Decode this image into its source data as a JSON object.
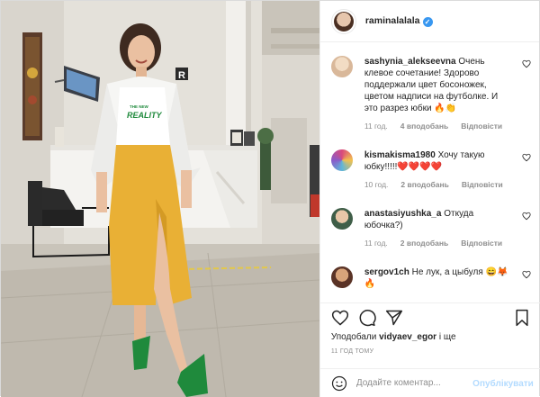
{
  "post": {
    "author": "raminalalala",
    "verified": true
  },
  "photo": {
    "tshirt_text_top": "THE NEW",
    "tshirt_text_main": "REALITY",
    "sign_letter": "R"
  },
  "comments": [
    {
      "username": "sashynia_alekseevna",
      "text": "Очень клевое сочетание! Здорово поддержали цвет босоножек, цветом надписи на футболке. И это разрез юбки 🔥👏",
      "age": "11 год.",
      "likes": "4 вподобань",
      "reply": "Відповісти",
      "avatar_color": "#e9d2b6"
    },
    {
      "username": "kismakisma1980",
      "text": "Хочу такую юбку!!!!!❤️❤️❤️❤️",
      "age": "10 год.",
      "likes": "2 вподобань",
      "reply": "Відповісти",
      "avatar_color": "#c94b8a"
    },
    {
      "username": "anastasiyushka_a",
      "text": "Откуда юбочка?)",
      "age": "11 год.",
      "likes": "2 вподобань",
      "reply": "Відповісти",
      "avatar_color": "#5b8a6b"
    },
    {
      "username": "sergov1ch",
      "text": "Не лук, а цыбуля 😄🦊🔥",
      "age": "",
      "likes": "",
      "reply": "",
      "avatar_color": "#7a4a3a"
    }
  ],
  "footer": {
    "liked_prefix": "Уподобали",
    "liked_user": "vidyaev_egor",
    "liked_suffix": "і ще",
    "time_ago": "11 ГОД ТОМУ",
    "comment_placeholder": "Додайте коментар...",
    "publish_label": "Опублікувати"
  },
  "colors": {
    "accent": "#3897f0",
    "publish_disabled": "#b3dbff",
    "skirt": "#e9b035",
    "shoes": "#1f8a3c"
  },
  "icons": [
    "verified-icon",
    "heart-icon",
    "comment-icon",
    "share-icon",
    "bookmark-icon",
    "emoji-icon"
  ]
}
